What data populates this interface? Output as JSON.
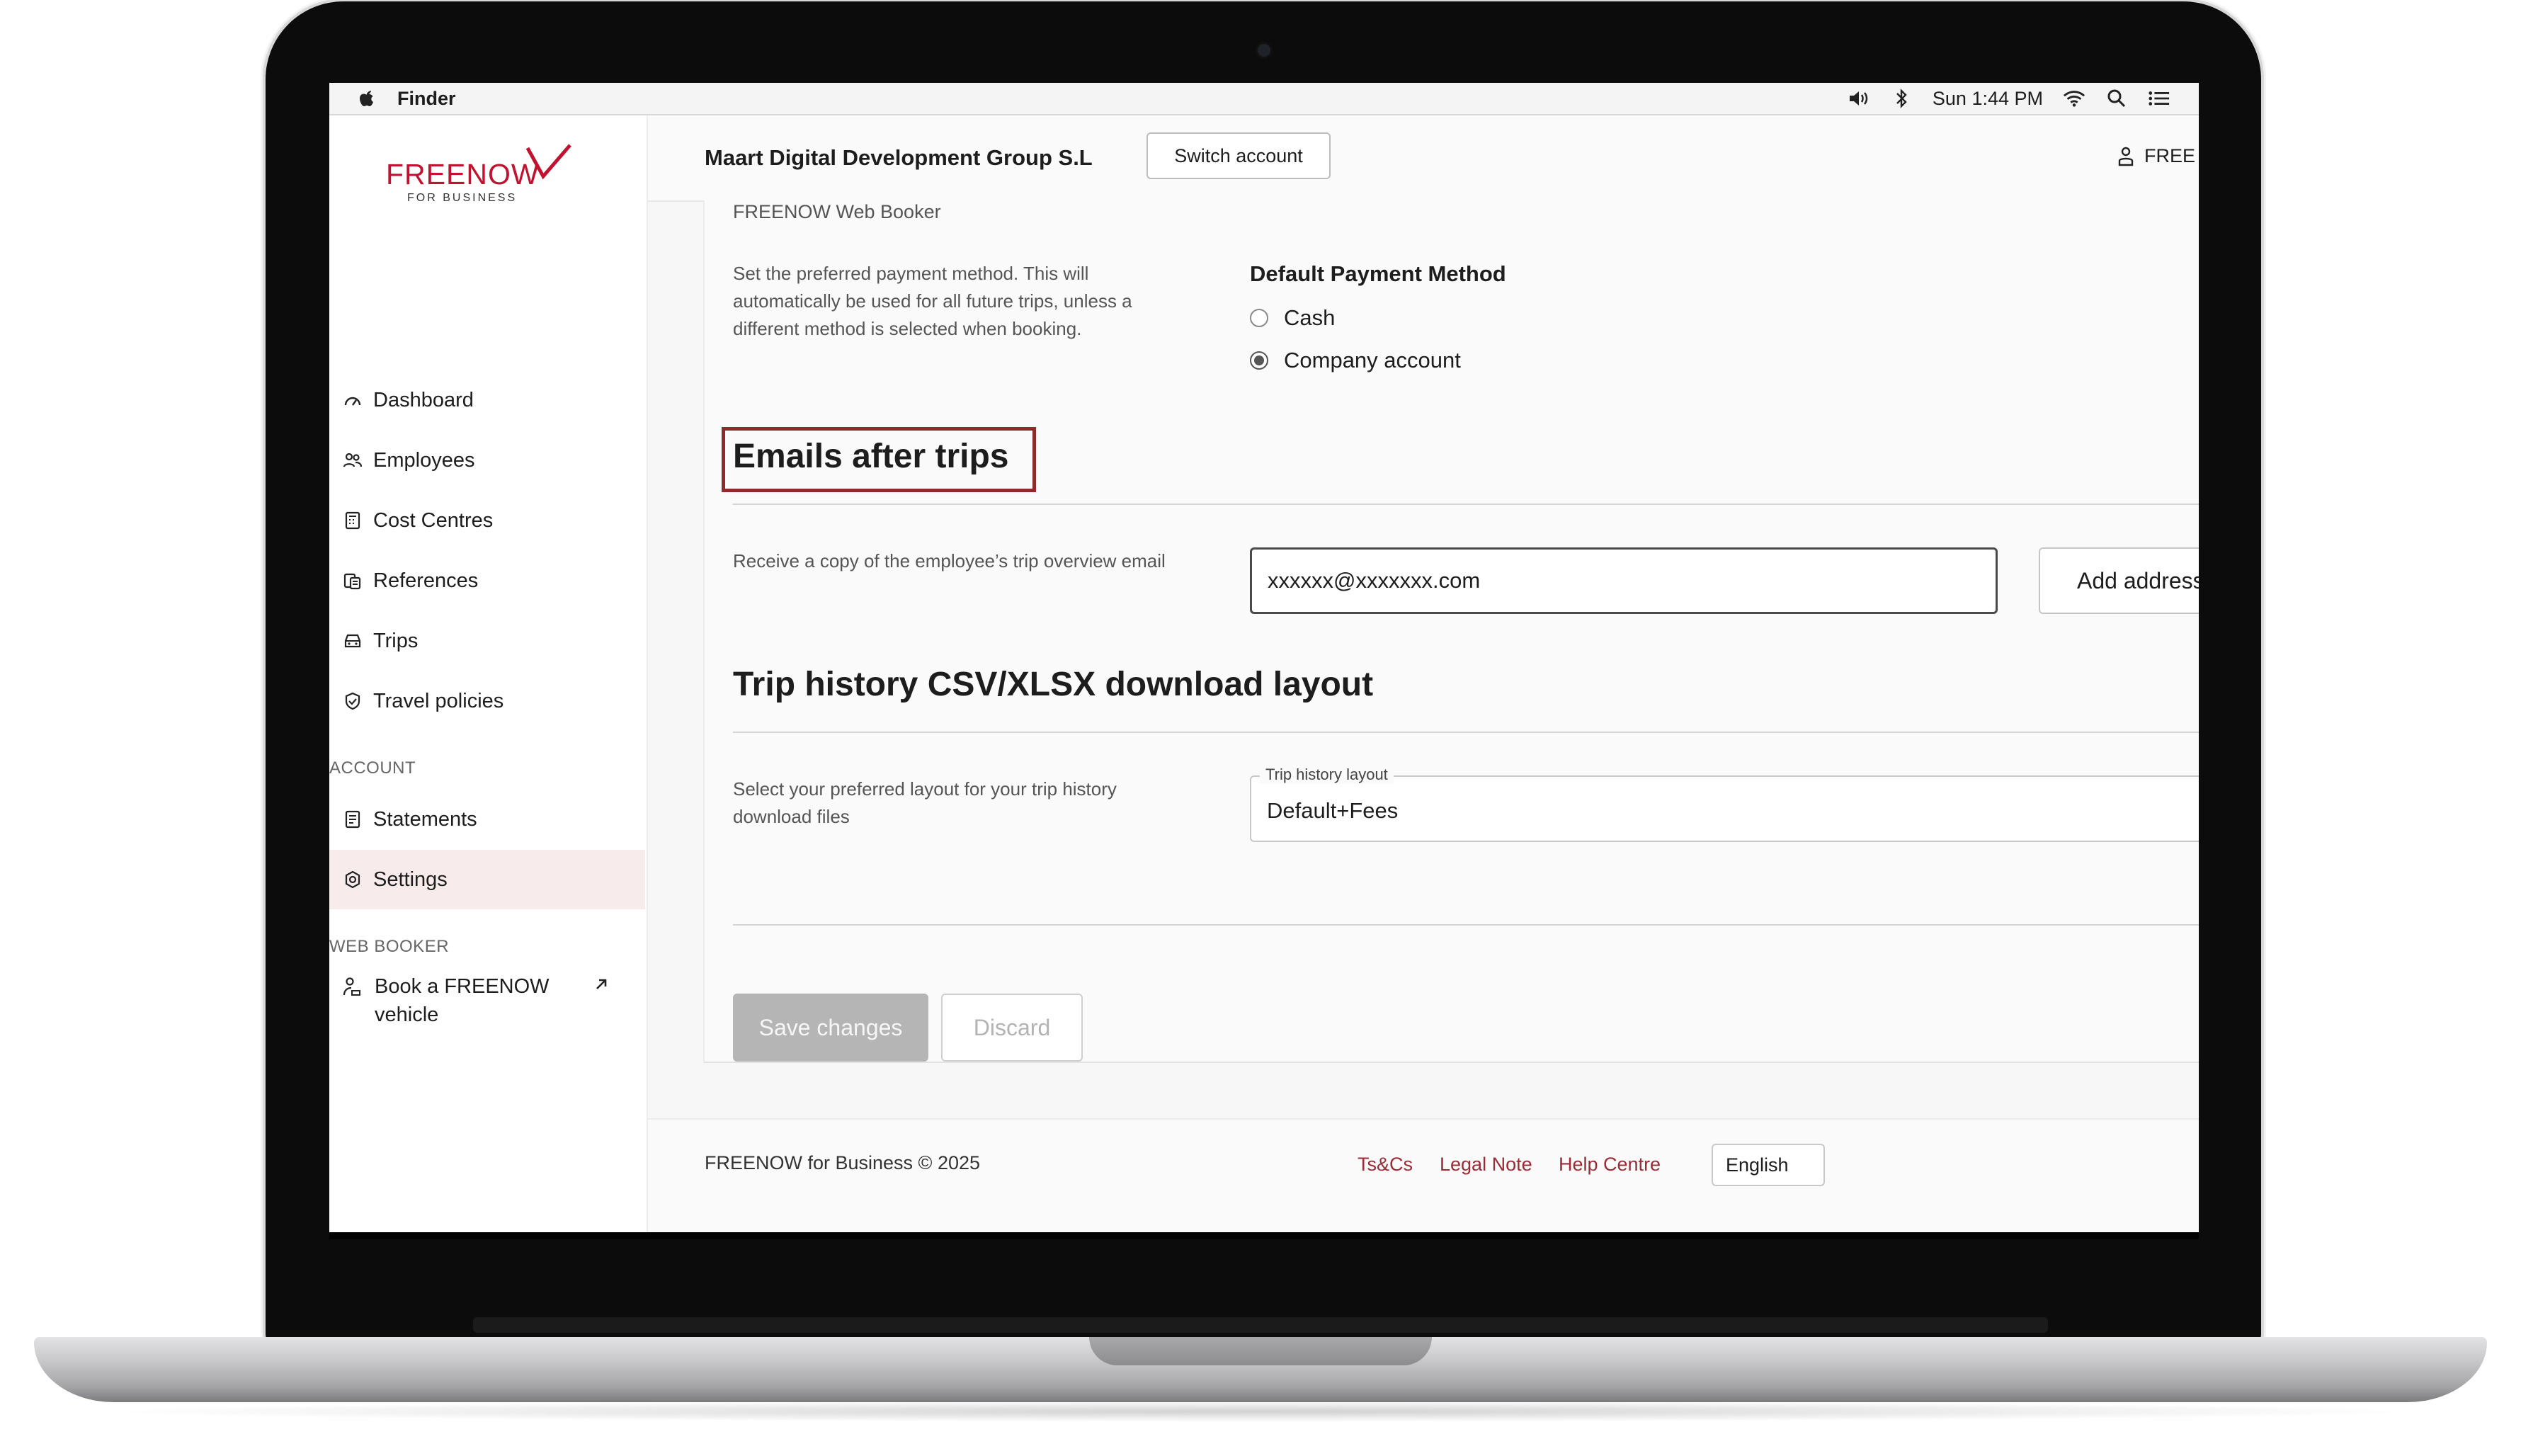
{
  "menubar": {
    "app_name": "Finder",
    "clock": "Sun 1:44 PM"
  },
  "sidebar": {
    "logo_word": "FREENOW",
    "logo_sub": "FOR BUSINESS",
    "items": [
      {
        "label": "Dashboard",
        "icon": "gauge-icon"
      },
      {
        "label": "Employees",
        "icon": "people-icon"
      },
      {
        "label": "Cost Centres",
        "icon": "calculator-icon"
      },
      {
        "label": "References",
        "icon": "clipboard-icon"
      },
      {
        "label": "Trips",
        "icon": "car-icon"
      },
      {
        "label": "Travel policies",
        "icon": "shield-icon"
      }
    ],
    "account_label": "ACCOUNT",
    "account_items": [
      {
        "label": "Statements",
        "icon": "document-icon"
      },
      {
        "label": "Settings",
        "icon": "gear-icon",
        "active": true
      }
    ],
    "web_booker_label": "WEB BOOKER",
    "book_label": "Book a FREENOW vehicle"
  },
  "header": {
    "company": "Maart Digital Development Group S.L",
    "switch_label": "Switch account",
    "user_label": "FREE"
  },
  "content": {
    "subtitle": "FREENOW Web Booker",
    "payment_desc": "Set the preferred payment method. This will automatically be used for all future trips, unless a different method is selected when booking.",
    "payment_title": "Default Payment Method",
    "payment_options": [
      "Cash",
      "Company account"
    ],
    "payment_selected": "Company account",
    "emails_title": "Emails after trips",
    "emails_desc": "Receive a copy of the employee’s trip overview email",
    "email_value": "xxxxxx@xxxxxxx.com",
    "add_label": "Add address",
    "history_title": "Trip history CSV/XLSX download layout",
    "history_desc": "Select your preferred layout for your trip history download files",
    "layout_label": "Trip history layout",
    "layout_value": "Default+Fees",
    "save_label": "Save changes",
    "discard_label": "Discard"
  },
  "footer": {
    "copyright": "FREENOW for Business © 2025",
    "links": [
      "Ts&Cs",
      "Legal Note",
      "Help Centre"
    ],
    "language": "English"
  },
  "colors": {
    "brand": "#c3122f",
    "link": "#9e2a35",
    "highlight_border": "#8f2a2a",
    "active_nav_bg": "#f8ebec"
  }
}
